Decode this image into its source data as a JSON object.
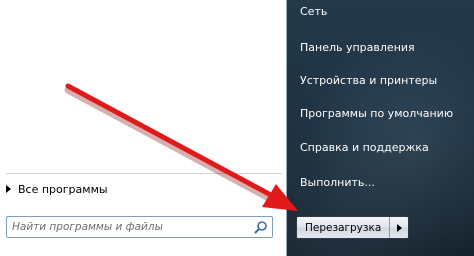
{
  "left": {
    "all_programs": "Все программы",
    "search_placeholder": "Найти программы и файлы"
  },
  "right": {
    "items": [
      "Сеть",
      "Панель управления",
      "Устройства и принтеры",
      "Программы по умолчанию",
      "Справка и поддержка",
      "Выполнить..."
    ],
    "shutdown_label": "Перезагрузка"
  },
  "annotation": {
    "arrow_color": "#e0191b"
  }
}
